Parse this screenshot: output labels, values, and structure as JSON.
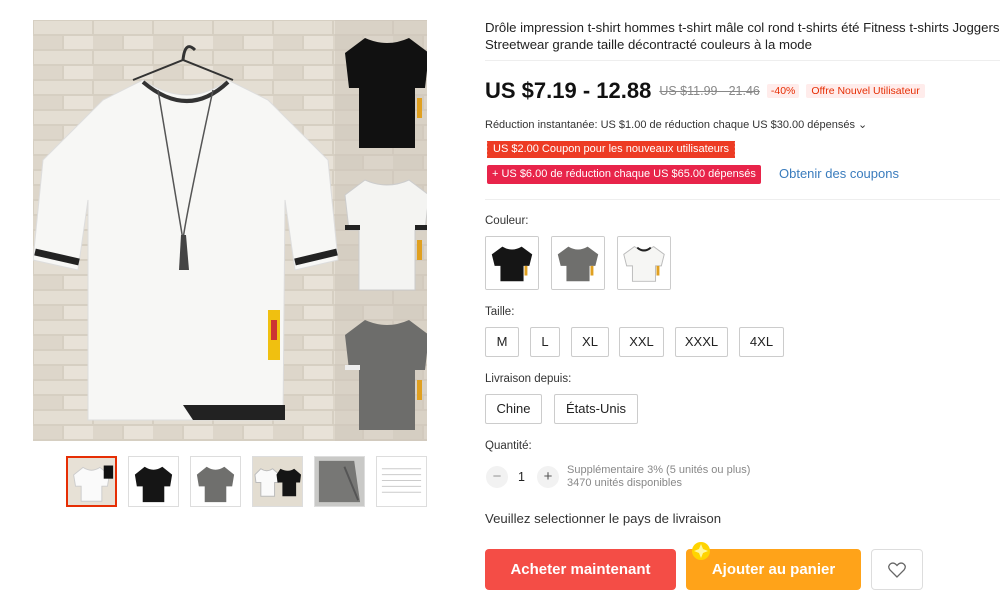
{
  "product": {
    "title": "Drôle impression t-shirt hommes t-shirt mâle col rond t-shirts été Fitness t-shirts Joggers Streetwear grande taille décontracté couleurs à la mode",
    "price": "US $7.19 - 12.88",
    "old_price": "US $11.99 - 21.46",
    "discount": "-40%",
    "new_user_tag": "Offre Nouvel Utilisateur",
    "instant_reduction": "Réduction instantanée: US $1.00 de réduction chaque US $30.00 dépensés ⌄",
    "coupon_new_users": "US $2.00 Coupon pour les nouveaux utilisateurs",
    "coupon_spend": "+ US $6.00 de réduction chaque US $65.00 dépensés",
    "get_coupons": "Obtenir des coupons"
  },
  "gallery": {
    "thumbnails": [
      "white-shirt",
      "black-shirt",
      "gray-shirt",
      "three-shirts",
      "gray-detail",
      "size-chart"
    ],
    "active_index": 0
  },
  "color": {
    "label": "Couleur:",
    "options": [
      "black",
      "gray",
      "white"
    ]
  },
  "size": {
    "label": "Taille:",
    "options": [
      "M",
      "L",
      "XL",
      "XXL",
      "XXXL",
      "4XL"
    ]
  },
  "shipping": {
    "label": "Livraison depuis:",
    "options": [
      "Chine",
      "États-Unis"
    ]
  },
  "quantity": {
    "label": "Quantité:",
    "minus": "−",
    "value": "1",
    "plus": "+",
    "note_line1": "Supplémentaire 3% (5 unités ou plus)",
    "note_line2": "3470 unités disponibles"
  },
  "ship_message": "Veuillez selectionner le pays de livraison",
  "actions": {
    "buy_now": "Acheter maintenant",
    "add_to_cart": "Ajouter au panier",
    "wishlist_icon": "heart-icon"
  },
  "colors": {
    "price_red": "#e62e04",
    "buy_button": "#f44d46",
    "cart_button": "#ffa319",
    "coupon_red": "#ed3b24",
    "coupon_pink": "#e8244a",
    "link_blue": "#3a7cbd"
  }
}
